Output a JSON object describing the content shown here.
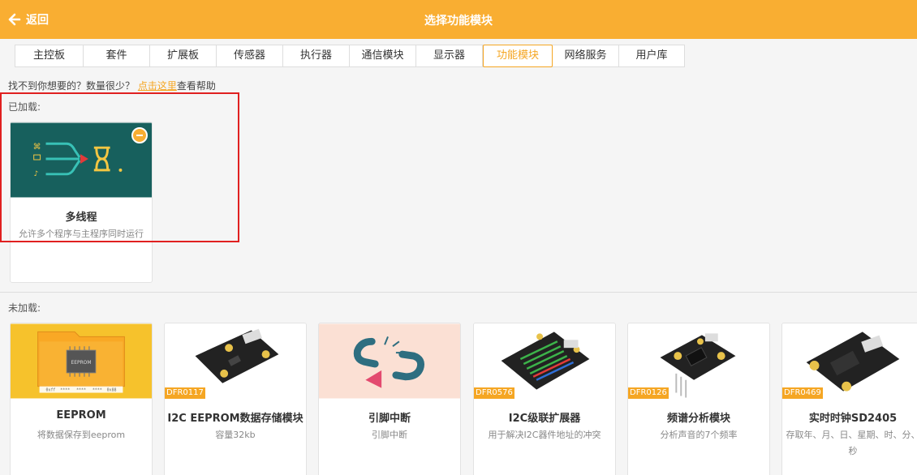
{
  "header": {
    "back_label": "返回",
    "title": "选择功能模块"
  },
  "tabs": [
    {
      "label": "主控板"
    },
    {
      "label": "套件"
    },
    {
      "label": "扩展板"
    },
    {
      "label": "传感器"
    },
    {
      "label": "执行器"
    },
    {
      "label": "通信模块"
    },
    {
      "label": "显示器"
    },
    {
      "label": "功能模块"
    },
    {
      "label": "网络服务"
    },
    {
      "label": "用户库"
    }
  ],
  "active_tab": "功能模块",
  "hint": {
    "text": "找不到你想要的？数量很少？ ",
    "link": "点击这里",
    "suffix": "查看帮助"
  },
  "loaded": {
    "label": "已加载:",
    "items": [
      {
        "name": "多线程",
        "desc": "允许多个程序与主程序同时运行"
      }
    ]
  },
  "unloaded": {
    "label": "未加载:",
    "items": [
      {
        "name": "EEPROM",
        "desc": "将数据保存到eeprom",
        "sku": ""
      },
      {
        "name": "I2C EEPROM数据存储模块",
        "desc": "容量32kb",
        "sku": "DFR0117"
      },
      {
        "name": "引脚中断",
        "desc": "引脚中断",
        "sku": ""
      },
      {
        "name": "I2C级联扩展器",
        "desc": "用于解决I2C器件地址的冲突",
        "sku": "DFR0576"
      },
      {
        "name": "频谱分析模块",
        "desc": "分析声音的7个频率",
        "sku": "DFR0126"
      },
      {
        "name": "实时时钟SD2405",
        "desc": "存取年、月、日、星期、时、分、秒",
        "sku": "DFR0469"
      }
    ],
    "eeprom_chip_label": "EEPROM",
    "eeprom_cells": [
      "0xff",
      "****",
      "****",
      "****",
      "0x88"
    ]
  },
  "colors": {
    "accent": "#f9ae32",
    "highlight": "#e02020",
    "thread_bg": "#17605d"
  },
  "icons": {
    "back": "arrow-left-icon",
    "remove": "minus-circle-icon"
  }
}
